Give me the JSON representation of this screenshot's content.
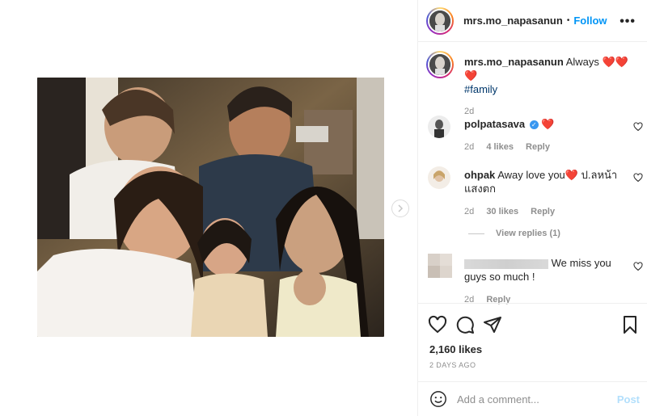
{
  "post": {
    "username": "mrs.mo_napasanun",
    "follow_label": "Follow",
    "dot": "•",
    "more_label": "•••"
  },
  "caption": {
    "username": "mrs.mo_napasanun",
    "text": "Always",
    "hearts": "❤️❤️❤️",
    "hashtag": "#family",
    "time": "2d"
  },
  "comments": [
    {
      "username": "polpatasava",
      "verified": true,
      "verified_icon": "✓",
      "text": "❤️",
      "time": "2d",
      "likes": "4 likes",
      "reply_label": "Reply"
    },
    {
      "username": "ohpak",
      "text": "Away love you",
      "heart": "❤️",
      "text2": "ป.ลหน้าแสงตก",
      "time": "2d",
      "likes": "30 likes",
      "reply_label": "Reply"
    },
    {
      "text": "We miss you guys so much  !",
      "time": "2d",
      "reply_label": "Reply"
    }
  ],
  "view_replies": "View replies (1)",
  "likes_count": "2,160 likes",
  "posted_date": "2 DAYS AGO",
  "add_comment": {
    "placeholder": "Add a comment...",
    "post_label": "Post"
  },
  "colors": {
    "accent": "#0095f6",
    "heart": "#ed4956",
    "muted": "#8e8e8e",
    "post_disabled": "#b2dffc"
  }
}
